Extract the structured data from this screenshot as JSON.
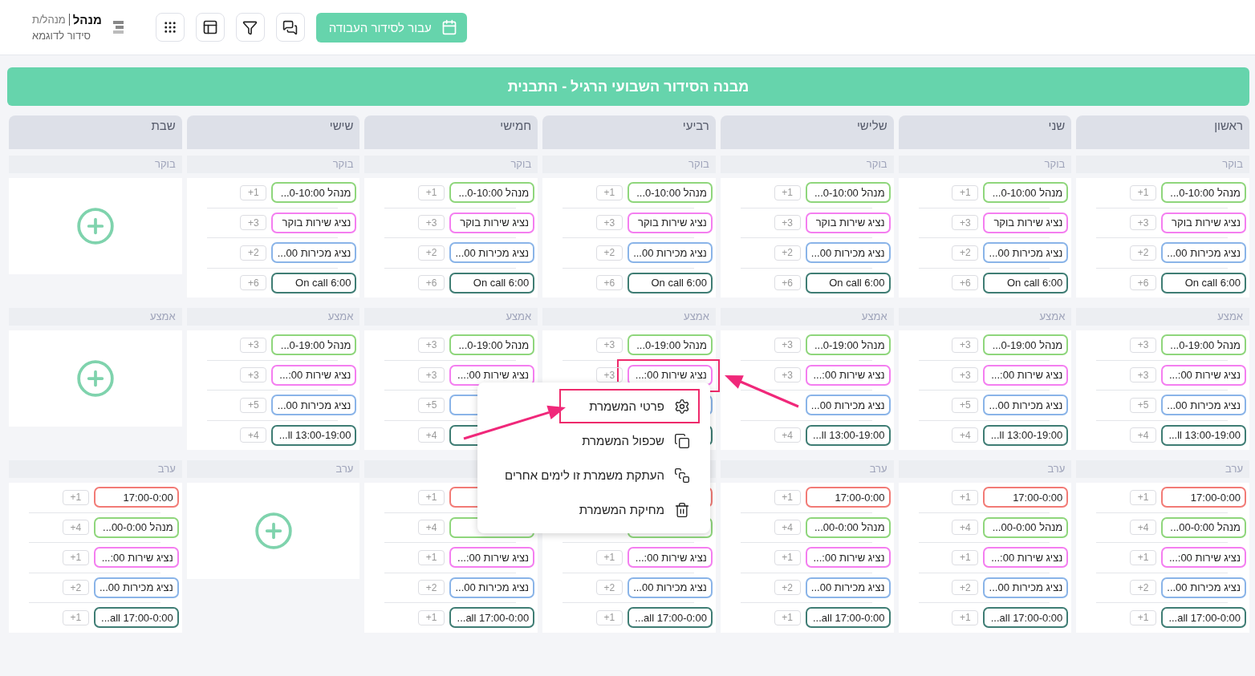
{
  "header": {
    "title": "מנהל",
    "role": "מנהל/ת",
    "subtitle": "סידור לדוגמא",
    "go_button": "עבור לסידור העבודה"
  },
  "banner": "מבנה הסידור השבועי הרגיל - התבנית",
  "days": [
    {
      "name": "ראשון",
      "sections": [
        {
          "label": "בוקר",
          "shifts": [
            {
              "label": "מנהל 0-10:00...",
              "count": "+1",
              "color": "#8fd67c",
              "highlighted": false
            },
            {
              "label": "נציג שירות בוקר",
              "count": "+3",
              "color": "#f47ef0",
              "highlighted": false
            },
            {
              "label": "נציג מכירות 00...",
              "count": "+2",
              "color": "#8ab4e8",
              "highlighted": false
            },
            {
              "label": "On call 6:00",
              "count": "+6",
              "color": "#3f7d74",
              "highlighted": false
            }
          ]
        },
        {
          "label": "אמצע",
          "shifts": [
            {
              "label": "מנהל 0-19:00...",
              "count": "+3",
              "color": "#8fd67c",
              "highlighted": false
            },
            {
              "label": "נציג שירות 00:...",
              "count": "+3",
              "color": "#f47ef0",
              "highlighted": false
            },
            {
              "label": "נציג מכירות 00...",
              "count": "+5",
              "color": "#8ab4e8",
              "highlighted": false
            },
            {
              "label": "ll 13:00-19:00...",
              "count": "+4",
              "color": "#3f7d74",
              "highlighted": false
            }
          ]
        },
        {
          "label": "ערב",
          "shifts": [
            {
              "label": "17:00-0:00",
              "count": "+1",
              "color": "#f27b76",
              "highlighted": false
            },
            {
              "label": "מנהל 00-0:00...",
              "count": "+4",
              "color": "#8fd67c",
              "highlighted": false
            },
            {
              "label": "נציג שירות 00:...",
              "count": "+1",
              "color": "#f47ef0",
              "highlighted": false
            },
            {
              "label": "נציג מכירות 00...",
              "count": "+2",
              "color": "#8ab4e8",
              "highlighted": false
            },
            {
              "label": "all 17:00-0:00...",
              "count": "+1",
              "color": "#3f7d74",
              "highlighted": false
            }
          ]
        }
      ]
    },
    {
      "name": "שני",
      "sections": [
        {
          "label": "בוקר",
          "shifts": [
            {
              "label": "מנהל 0-10:00...",
              "count": "+1",
              "color": "#8fd67c",
              "highlighted": false
            },
            {
              "label": "נציג שירות בוקר",
              "count": "+3",
              "color": "#f47ef0",
              "highlighted": false
            },
            {
              "label": "נציג מכירות 00...",
              "count": "+2",
              "color": "#8ab4e8",
              "highlighted": false
            },
            {
              "label": "On call 6:00",
              "count": "+6",
              "color": "#3f7d74",
              "highlighted": false
            }
          ]
        },
        {
          "label": "אמצע",
          "shifts": [
            {
              "label": "מנהל 0-19:00...",
              "count": "+3",
              "color": "#8fd67c",
              "highlighted": false
            },
            {
              "label": "נציג שירות 00:...",
              "count": "+3",
              "color": "#f47ef0",
              "highlighted": false
            },
            {
              "label": "נציג מכירות 00...",
              "count": "+5",
              "color": "#8ab4e8",
              "highlighted": false
            },
            {
              "label": "ll 13:00-19:00...",
              "count": "+4",
              "color": "#3f7d74",
              "highlighted": false
            }
          ]
        },
        {
          "label": "ערב",
          "shifts": [
            {
              "label": "17:00-0:00",
              "count": "+1",
              "color": "#f27b76",
              "highlighted": false
            },
            {
              "label": "מנהל 00-0:00...",
              "count": "+4",
              "color": "#8fd67c",
              "highlighted": false
            },
            {
              "label": "נציג שירות 00:...",
              "count": "+1",
              "color": "#f47ef0",
              "highlighted": false
            },
            {
              "label": "נציג מכירות 00...",
              "count": "+2",
              "color": "#8ab4e8",
              "highlighted": false
            },
            {
              "label": "all 17:00-0:00...",
              "count": "+1",
              "color": "#3f7d74",
              "highlighted": false
            }
          ]
        }
      ]
    },
    {
      "name": "שלישי",
      "sections": [
        {
          "label": "בוקר",
          "shifts": [
            {
              "label": "מנהל 0-10:00...",
              "count": "+1",
              "color": "#8fd67c",
              "highlighted": false
            },
            {
              "label": "נציג שירות בוקר",
              "count": "+3",
              "color": "#f47ef0",
              "highlighted": false
            },
            {
              "label": "נציג מכירות 00...",
              "count": "+2",
              "color": "#8ab4e8",
              "highlighted": false
            },
            {
              "label": "On call 6:00",
              "count": "+6",
              "color": "#3f7d74",
              "highlighted": false
            }
          ]
        },
        {
          "label": "אמצע",
          "shifts": [
            {
              "label": "מנהל 0-19:00...",
              "count": "+3",
              "color": "#8fd67c",
              "highlighted": false
            },
            {
              "label": "נציג שירות 00:...",
              "count": "+3",
              "color": "#f47ef0",
              "highlighted": false
            },
            {
              "label": "נציג מכירות 00...",
              "color": "#8ab4e8",
              "highlighted": false
            },
            {
              "label": "ll 13:00-19:00...",
              "count": "+4",
              "color": "#3f7d74",
              "highlighted": false
            }
          ]
        },
        {
          "label": "ערב",
          "shifts": [
            {
              "label": "17:00-0:00",
              "count": "+1",
              "color": "#f27b76",
              "highlighted": false
            },
            {
              "label": "מנהל 00-0:00...",
              "count": "+4",
              "color": "#8fd67c",
              "highlighted": false
            },
            {
              "label": "נציג שירות 00:...",
              "count": "+1",
              "color": "#f47ef0",
              "highlighted": false
            },
            {
              "label": "נציג מכירות 00...",
              "count": "+2",
              "color": "#8ab4e8",
              "highlighted": false
            },
            {
              "label": "all 17:00-0:00...",
              "count": "+1",
              "color": "#3f7d74",
              "highlighted": false
            }
          ]
        }
      ]
    },
    {
      "name": "רביעי",
      "sections": [
        {
          "label": "בוקר",
          "shifts": [
            {
              "label": "מנהל 0-10:00...",
              "count": "+1",
              "color": "#8fd67c",
              "highlighted": false
            },
            {
              "label": "נציג שירות בוקר",
              "count": "+3",
              "color": "#f47ef0",
              "highlighted": false
            },
            {
              "label": "נציג מכירות 00...",
              "count": "+2",
              "color": "#8ab4e8",
              "highlighted": false
            },
            {
              "label": "On call 6:00",
              "count": "+6",
              "color": "#3f7d74",
              "highlighted": false
            }
          ]
        },
        {
          "label": "אמצע",
          "shifts": [
            {
              "label": "מנהל 0-19:00...",
              "count": "+3",
              "color": "#8fd67c",
              "highlighted": false
            },
            {
              "label": "נציג שירות 00:...",
              "count": "+3",
              "color": "#f47ef0",
              "highlighted": true
            },
            {
              "color": "#8ab4e8",
              "highlighted": false
            },
            {
              "color": "#3f7d74",
              "highlighted": false
            }
          ]
        },
        {
          "shifts": [
            {
              "color": "#f27b76",
              "highlighted": false
            },
            {
              "color": "#8fd67c",
              "highlighted": false
            },
            {
              "label": "נציג שירות 00:...",
              "count": "+1",
              "color": "#f47ef0",
              "highlighted": false
            },
            {
              "label": "נציג מכירות 00...",
              "count": "+2",
              "color": "#8ab4e8",
              "highlighted": false
            },
            {
              "label": "all 17:00-0:00...",
              "count": "+1",
              "color": "#3f7d74",
              "highlighted": false
            }
          ]
        }
      ]
    },
    {
      "name": "חמישי",
      "sections": [
        {
          "label": "בוקר",
          "shifts": [
            {
              "label": "מנהל 0-10:00...",
              "count": "+1",
              "color": "#8fd67c",
              "highlighted": false
            },
            {
              "label": "נציג שירות בוקר",
              "count": "+3",
              "color": "#f47ef0",
              "highlighted": false
            },
            {
              "label": "נציג מכירות 00...",
              "count": "+2",
              "color": "#8ab4e8",
              "highlighted": false
            },
            {
              "label": "On call 6:00",
              "count": "+6",
              "color": "#3f7d74",
              "highlighted": false
            }
          ]
        },
        {
          "label": "אמצע",
          "shifts": [
            {
              "label": "מנהל 0-19:00...",
              "count": "+3",
              "color": "#8fd67c",
              "highlighted": false
            },
            {
              "label": "נציג שירות 00:...",
              "count": "+3",
              "color": "#f47ef0",
              "highlighted": false
            },
            {
              "count": "+5",
              "color": "#8ab4e8",
              "highlighted": false
            },
            {
              "count": "+4",
              "color": "#3f7d74",
              "highlighted": false
            }
          ]
        },
        {
          "shifts": [
            {
              "count": "+1",
              "color": "#f27b76",
              "highlighted": false
            },
            {
              "count": "+4",
              "color": "#8fd67c",
              "highlighted": false
            },
            {
              "label": "נציג שירות 00:...",
              "count": "+1",
              "color": "#f47ef0",
              "highlighted": false
            },
            {
              "label": "נציג מכירות 00...",
              "count": "+2",
              "color": "#8ab4e8",
              "highlighted": false
            },
            {
              "label": "all 17:00-0:00...",
              "count": "+1",
              "color": "#3f7d74",
              "highlighted": false
            }
          ]
        }
      ]
    },
    {
      "name": "שישי",
      "sections": [
        {
          "label": "בוקר",
          "shifts": [
            {
              "label": "מנהל 0-10:00...",
              "count": "+1",
              "color": "#8fd67c",
              "highlighted": false
            },
            {
              "label": "נציג שירות בוקר",
              "count": "+3",
              "color": "#f47ef0",
              "highlighted": false
            },
            {
              "label": "נציג מכירות 00...",
              "count": "+2",
              "color": "#8ab4e8",
              "highlighted": false
            },
            {
              "label": "On call 6:00",
              "count": "+6",
              "color": "#3f7d74",
              "highlighted": false
            }
          ]
        },
        {
          "label": "אמצע",
          "shifts": [
            {
              "label": "מנהל 0-19:00...",
              "count": "+3",
              "color": "#8fd67c",
              "highlighted": false
            },
            {
              "label": "נציג שירות 00:...",
              "count": "+3",
              "color": "#f47ef0",
              "highlighted": false
            },
            {
              "label": "נציג מכירות 00...",
              "count": "+5",
              "color": "#8ab4e8",
              "highlighted": false
            },
            {
              "label": "ll 13:00-19:00...",
              "count": "+4",
              "color": "#3f7d74",
              "highlighted": false
            }
          ]
        },
        {
          "label": "ערב"
        }
      ]
    },
    {
      "name": "שבת",
      "sections": [
        {
          "label": "בוקר"
        },
        {
          "label": "אמצע"
        },
        {
          "label": "ערב",
          "shifts": [
            {
              "label": "17:00-0:00",
              "count": "+1",
              "color": "#f27b76",
              "highlighted": false
            },
            {
              "label": "מנהל 00-0:00...",
              "count": "+4",
              "color": "#8fd67c",
              "highlighted": false
            },
            {
              "label": "נציג שירות 00:...",
              "count": "+1",
              "color": "#f47ef0",
              "highlighted": false
            },
            {
              "label": "נציג מכירות 00...",
              "count": "+2",
              "color": "#8ab4e8",
              "highlighted": false
            },
            {
              "label": "all 17:00-0:00...",
              "count": "+1",
              "color": "#3f7d74",
              "highlighted": false
            }
          ]
        }
      ]
    }
  ],
  "context_menu": {
    "items": [
      {
        "kind": "settings",
        "label": "פרטי המשמרת",
        "highlighted": true
      },
      {
        "kind": "duplicate",
        "label": "שכפול המשמרת",
        "highlighted": false
      },
      {
        "kind": "copy",
        "label": "העתקת משמרת זו לימים אחרים",
        "highlighted": false
      },
      {
        "kind": "delete",
        "label": "מחיקת המשמרת",
        "highlighted": false
      }
    ]
  }
}
